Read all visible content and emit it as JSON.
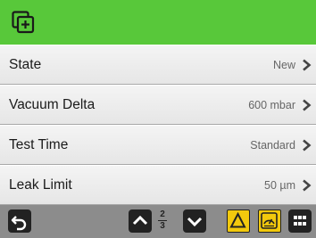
{
  "header": {
    "icon": "window-add-icon",
    "color": "#58c83a"
  },
  "rows": [
    {
      "label": "State",
      "value": "New"
    },
    {
      "label": "Vacuum Delta",
      "value": "600 mbar"
    },
    {
      "label": "Test Time",
      "value": "Standard"
    },
    {
      "label": "Leak Limit",
      "value": "50 µm"
    }
  ],
  "footer": {
    "back_icon": "back-arrow-icon",
    "up_icon": "chevron-up-icon",
    "down_icon": "chevron-down-icon",
    "page_current": "2",
    "page_total": "3",
    "warning_icon": "warning-triangle-icon",
    "gauge_icon": "gauge-icon",
    "menu_icon": "grid-menu-icon",
    "accent": "#f2c90d"
  }
}
